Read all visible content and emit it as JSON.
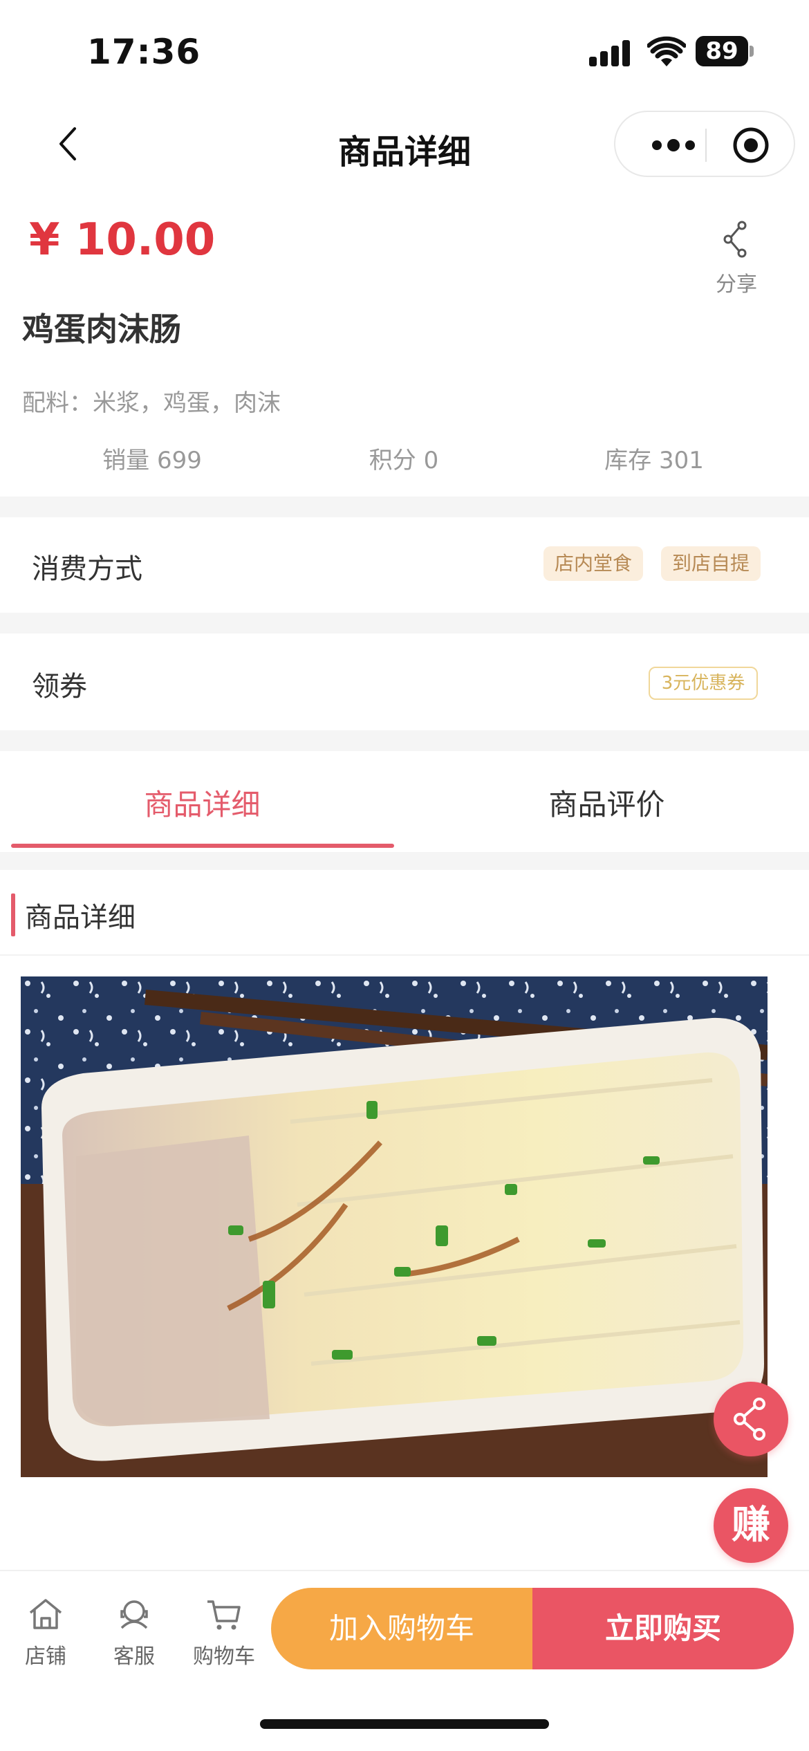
{
  "status_bar": {
    "time": "17:36",
    "battery": "89"
  },
  "nav": {
    "title": "商品详细"
  },
  "product": {
    "price": "¥ 10.00",
    "share_label": "分享",
    "name": "鸡蛋肉沫肠",
    "ingredients": "配料：米浆，鸡蛋，肉沫",
    "sales": "销量 699",
    "points": "积分 0",
    "stock": "库存 301"
  },
  "consumption": {
    "label": "消费方式",
    "tags": [
      "店内堂食",
      "到店自提"
    ]
  },
  "coupon": {
    "label": "领券",
    "badge": "3元优惠券"
  },
  "tabs": [
    {
      "label": "商品详细",
      "active": true
    },
    {
      "label": "商品评价",
      "active": false
    }
  ],
  "detail_section": {
    "title": "商品详细"
  },
  "fab": {
    "earn_label": "赚"
  },
  "bottom_bar": {
    "items": [
      {
        "label": "店铺",
        "icon": "home-icon"
      },
      {
        "label": "客服",
        "icon": "customer-service-icon"
      },
      {
        "label": "购物车",
        "icon": "cart-icon"
      }
    ],
    "add_to_cart": "加入购物车",
    "buy_now": "立即购买"
  },
  "colors": {
    "price_red": "#e0363f",
    "accent_pink": "#e45b6b",
    "cart_orange": "#f6a846",
    "buy_red": "#ea5564"
  }
}
